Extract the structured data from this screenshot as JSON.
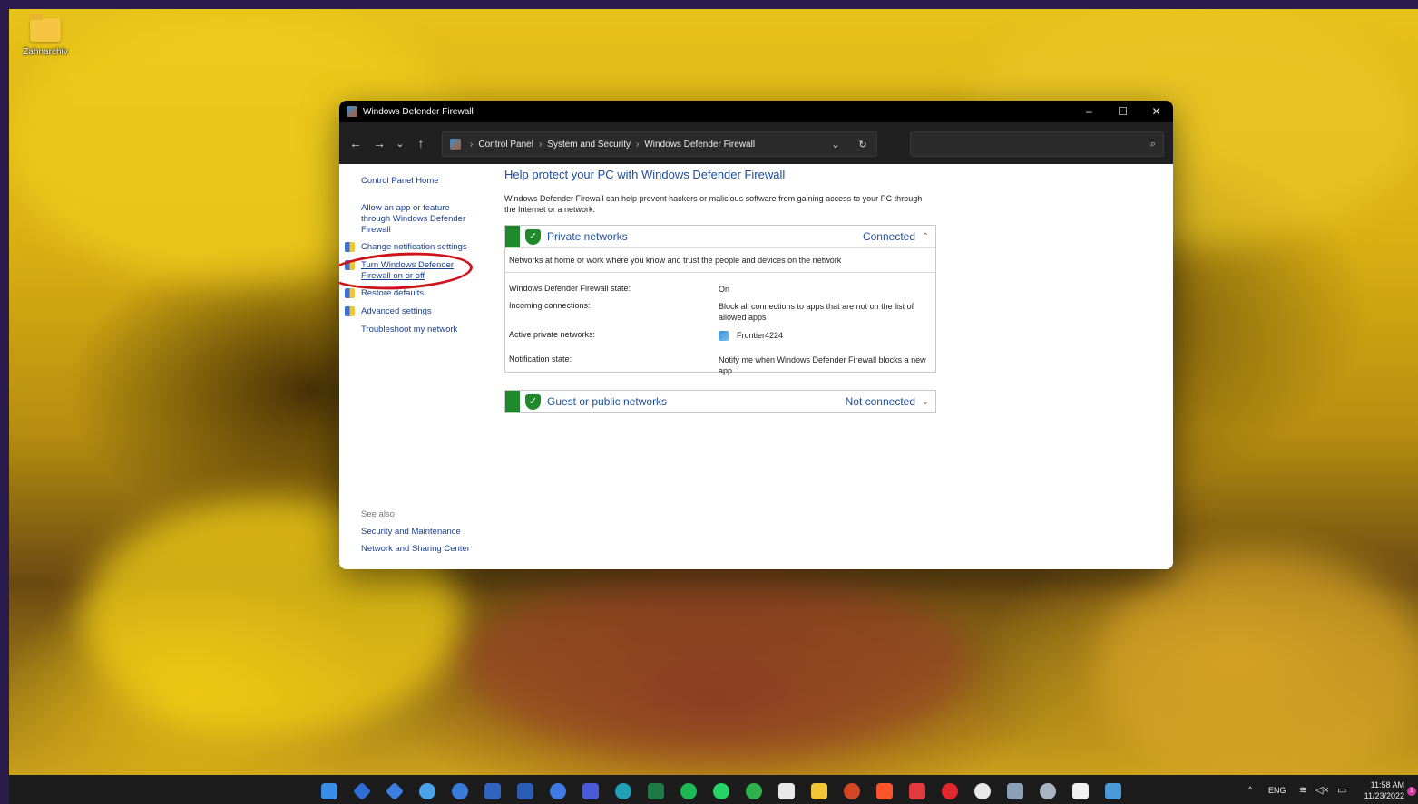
{
  "desktop": {
    "icon_label": "Zahnarchiv"
  },
  "window": {
    "title": "Windows Defender Firewall",
    "minimize": "–",
    "maximize": "☐",
    "close": "✕"
  },
  "nav": {
    "back": "←",
    "forward": "→",
    "recent": "⌄",
    "up": "↑"
  },
  "address": {
    "crumbs": [
      "Control Panel",
      "System and Security",
      "Windows Defender Firewall"
    ],
    "sep": "›",
    "dropdown": "⌄",
    "refresh": "↻"
  },
  "search": {
    "placeholder": "",
    "icon": "⌕"
  },
  "sidebar": {
    "home": "Control Panel Home",
    "items": [
      "Allow an app or feature through Windows Defender Firewall",
      "Change notification settings",
      "Turn Windows Defender Firewall on or off",
      "Restore defaults",
      "Advanced settings",
      "Troubleshoot my network"
    ],
    "see_also_label": "See also",
    "see_also": [
      "Security and Maintenance",
      "Network and Sharing Center"
    ]
  },
  "main": {
    "heading": "Help protect your PC with Windows Defender Firewall",
    "intro": "Windows Defender Firewall can help prevent hackers or malicious software from gaining access to your PC through the Internet or a network.",
    "private": {
      "title": "Private networks",
      "status": "Connected",
      "chevron": "⌃",
      "description": "Networks at home or work where you know and trust the people and devices on the network",
      "rows": [
        {
          "label": "Windows Defender Firewall state:",
          "value": "On"
        },
        {
          "label": "Incoming connections:",
          "value": "Block all connections to apps that are not on the list of allowed apps"
        },
        {
          "label": "Active private networks:",
          "value": "Frontier4224"
        },
        {
          "label": "Notification state:",
          "value": "Notify me when Windows Defender Firewall blocks a new app"
        }
      ]
    },
    "public": {
      "title": "Guest or public networks",
      "status": "Not connected",
      "chevron": "⌄"
    }
  },
  "taskbar": {
    "tray_chevron": "^",
    "lang": "ENG",
    "time": "11:58 AM",
    "date": "11/23/2022",
    "notification_count": "1"
  }
}
